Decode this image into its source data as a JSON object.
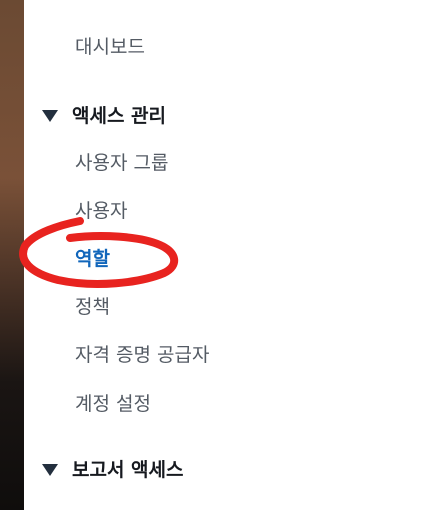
{
  "sidebar": {
    "dashboard_label": "대시보드",
    "access_management": {
      "header_label": "액세스 관리",
      "items": [
        {
          "label": "사용자 그룹"
        },
        {
          "label": "사용자"
        },
        {
          "label": "역할",
          "active": true
        },
        {
          "label": "정책"
        },
        {
          "label": "자격 증명 공급자"
        },
        {
          "label": "계정 설정"
        }
      ]
    },
    "access_reports": {
      "header_label": "보고서 액세스"
    }
  },
  "colors": {
    "active_link": "#1166bb",
    "nav_text": "#545b64",
    "section_text": "#16191f",
    "annotation": "#e8231f"
  },
  "icons": {
    "section_toggle": "caret-down-icon"
  }
}
